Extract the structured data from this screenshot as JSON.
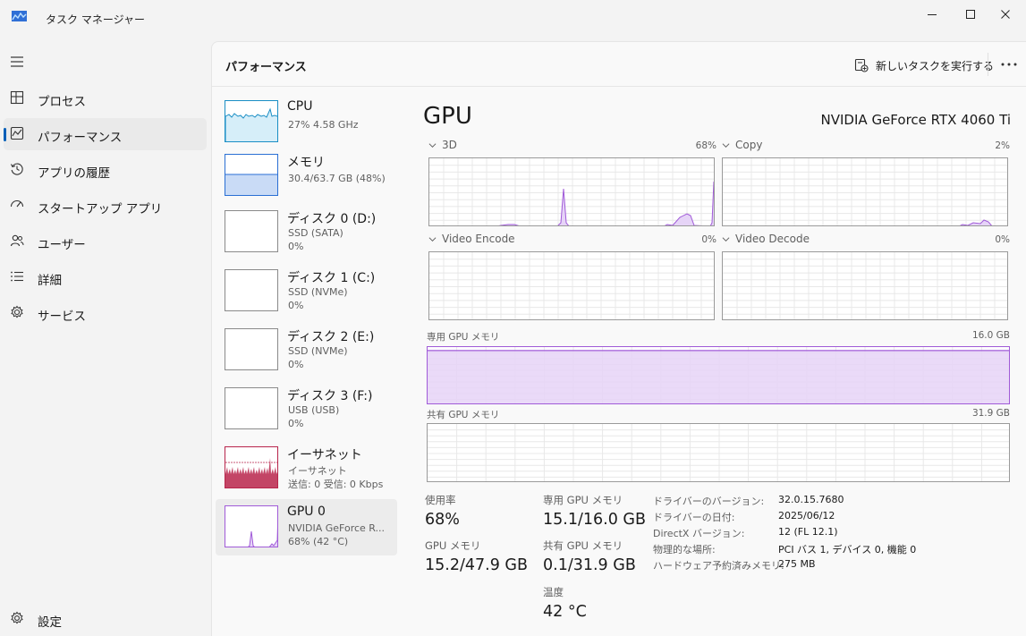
{
  "window": {
    "title": "タスク マネージャー",
    "icon": "task-manager-icon"
  },
  "nav": {
    "items": [
      {
        "label": "プロセス",
        "icon": "processes-icon"
      },
      {
        "label": "パフォーマンス",
        "icon": "performance-icon"
      },
      {
        "label": "アプリの履歴",
        "icon": "app-history-icon"
      },
      {
        "label": "スタートアップ アプリ",
        "icon": "startup-icon"
      },
      {
        "label": "ユーザー",
        "icon": "users-icon"
      },
      {
        "label": "詳細",
        "icon": "details-icon"
      },
      {
        "label": "サービス",
        "icon": "services-icon"
      }
    ],
    "settings_label": "設定",
    "active_index": 1
  },
  "header": {
    "title": "パフォーマンス",
    "run_task_label": "新しいタスクを実行する"
  },
  "devices": [
    {
      "name": "CPU",
      "line1": "27%  4.58 GHz",
      "line2": ""
    },
    {
      "name": "メモリ",
      "line1": "30.4/63.7 GB (48%)",
      "line2": ""
    },
    {
      "name": "ディスク 0 (D:)",
      "line1": "SSD (SATA)",
      "line2": "0%"
    },
    {
      "name": "ディスク 1 (C:)",
      "line1": "SSD (NVMe)",
      "line2": "0%"
    },
    {
      "name": "ディスク 2 (E:)",
      "line1": "SSD (NVMe)",
      "line2": "0%"
    },
    {
      "name": "ディスク 3 (F:)",
      "line1": "USB (USB)",
      "line2": "0%"
    },
    {
      "name": "イーサネット",
      "line1": "イーサネット",
      "line2": "送信: 0 受信: 0 Kbps"
    },
    {
      "name": "GPU 0",
      "line1": "NVIDIA GeForce R...",
      "line2": "68% (42 °C)"
    }
  ],
  "gpu": {
    "title": "GPU",
    "model": "NVIDIA GeForce RTX 4060 Ti",
    "engines": [
      {
        "name": "3D",
        "percent": "68%"
      },
      {
        "name": "Copy",
        "percent": "2%"
      },
      {
        "name": "Video Encode",
        "percent": "0%"
      },
      {
        "name": "Video Decode",
        "percent": "0%"
      }
    ],
    "dedicated_label": "専用 GPU メモリ",
    "dedicated_max": "16.0 GB",
    "dedicated_fill": 0.94,
    "shared_label": "共有 GPU メモリ",
    "shared_max": "31.9 GB",
    "shared_fill": 0.0,
    "stats": {
      "usage_label": "使用率",
      "usage_value": "68%",
      "gpu_mem_label": "GPU メモリ",
      "gpu_mem_value": "15.2/47.9 GB",
      "ded_label": "専用 GPU メモリ",
      "ded_value": "15.1/16.0 GB",
      "shared_label": "共有 GPU メモリ",
      "shared_value": "0.1/31.9 GB",
      "temp_label": "温度",
      "temp_value": "42 °C"
    },
    "info": [
      {
        "key": "ドライバーのバージョン:",
        "value": "32.0.15.7680"
      },
      {
        "key": "ドライバーの日付:",
        "value": "2025/06/12"
      },
      {
        "key": "DirectX バージョン:",
        "value": "12 (FL 12.1)"
      },
      {
        "key": "物理的な場所:",
        "value": "PCI バス 1, デバイス 0, 機能 0"
      },
      {
        "key": "ハードウェア予約済みメモリ:",
        "value": "275 MB"
      }
    ]
  },
  "colors": {
    "gpu": "#a05ad8",
    "gpu_fill": "#e6d4f7",
    "cpu": "#1a8ec5",
    "cpu_fill": "#d6eef9",
    "memory": "#2a6fd4",
    "memory_fill": "#c9dbf6",
    "ethernet": "#b8254b",
    "grid": "#e8e8e8"
  }
}
